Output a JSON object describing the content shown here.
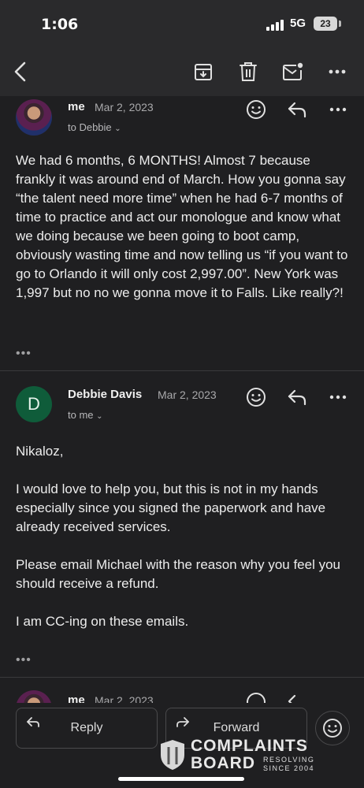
{
  "status_bar": {
    "time": "1:06",
    "network": "5G",
    "battery": "23"
  },
  "toolbar": {
    "icons": [
      "back-chevron-icon",
      "archive-icon",
      "trash-icon",
      "mark-unread-icon",
      "more-icon"
    ]
  },
  "messages": [
    {
      "sender": "me",
      "date": "Mar 2, 2023",
      "to": "to Debbie",
      "avatar": "photo",
      "body": "We had 6 months, 6 MONTHS! Almost 7 because frankly it was around end of March. How you gonna say “the talent need more time” when he had 6-7 months of time to practice and act our monologue and know what we doing because we been going to boot camp, obviously wasting time and now telling us “if you want to go to Orlando it will only  cost 2,997.00”. New York was 1,997 but no no we gonna move it to Falls. Like really?!",
      "ellipsis": "•••"
    },
    {
      "sender": "Debbie Davis",
      "date": "Mar 2, 2023",
      "to": "to me",
      "avatar_letter": "D",
      "body": "Nikaloz,\n\nI would love to help you, but this is not in my hands especially since you signed the paperwork and have already received services.\n\nPlease email Michael with the reason why you feel you should receive a refund.\n\nI am CC-ing on these emails.",
      "ellipsis": "•••"
    },
    {
      "sender": "me",
      "date": "Mar 2, 2023"
    }
  ],
  "actions": {
    "reply_label": "Reply",
    "forward_label": "Forward"
  },
  "watermark": {
    "line1": "COMPLAINTS",
    "line2": "BOARD",
    "tag1": "RESOLVING",
    "tag2": "SINCE 2004"
  },
  "colors": {
    "background": "#1f1f21",
    "toolbar": "#2a2a2c",
    "avatar_green": "#0f5c3a"
  }
}
